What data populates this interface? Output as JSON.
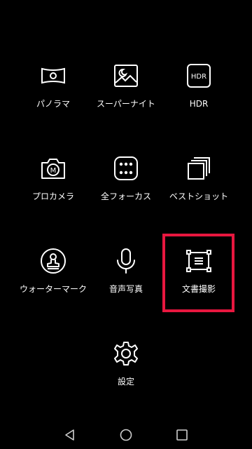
{
  "accent_color": "#e8173f",
  "modes": [
    {
      "label": "パノラマ",
      "icon": "panorama-icon"
    },
    {
      "label": "スーパーナイト",
      "icon": "night-landscape-icon"
    },
    {
      "label": "HDR",
      "icon": "hdr-icon",
      "icon_text": "HDR"
    },
    {
      "label": "プロカメラ",
      "icon": "pro-camera-icon",
      "icon_text": "M"
    },
    {
      "label": "全フォーカス",
      "icon": "all-focus-icon"
    },
    {
      "label": "ベストショット",
      "icon": "best-shot-icon"
    },
    {
      "label": "ウォーターマーク",
      "icon": "watermark-stamp-icon"
    },
    {
      "label": "音声写真",
      "icon": "microphone-icon"
    },
    {
      "label": "文書撮影",
      "icon": "document-scan-icon",
      "highlighted": true
    },
    {
      "label": "設定",
      "icon": "settings-gear-icon"
    }
  ],
  "navigation": {
    "back": "back-triangle-icon",
    "home": "home-circle-icon",
    "recents": "recents-square-icon"
  }
}
